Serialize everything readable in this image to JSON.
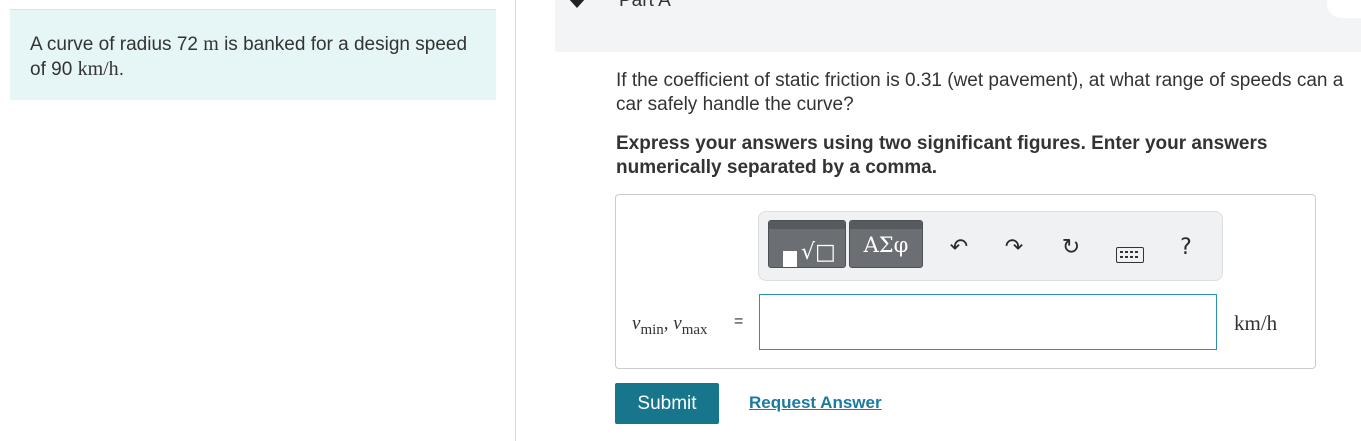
{
  "problem": {
    "text_before_radius": "A curve of radius",
    "radius_value": "72",
    "radius_unit": "m",
    "text_middle": "is banked for a design speed of",
    "speed_value": "90",
    "speed_unit": "km/h",
    "text_end": "."
  },
  "part": {
    "title": "Part A"
  },
  "question": "If the coefficient of static friction is 0.31 (wet pavement), at what range of speeds can a car safely handle the curve?",
  "instruction": "Express your answers using two significant figures. Enter your answers numerically separated by a comma.",
  "toolbar": {
    "templates_glyph": "√□",
    "symbols_label": "ΑΣφ",
    "undo_glyph": "↶",
    "redo_glyph": "↷",
    "reset_glyph": "↻",
    "help_glyph": "?"
  },
  "answer": {
    "var1": "v",
    "var1_sub": "min",
    "separator": ",",
    "var2": "v",
    "var2_sub": "max",
    "equals": "=",
    "value": "",
    "unit": "km/h"
  },
  "buttons": {
    "submit": "Submit",
    "request_answer": "Request Answer"
  },
  "colors": {
    "intro_bg": "#e6f6f7",
    "submit_bg": "#17758c",
    "link": "#1b7aa0"
  }
}
